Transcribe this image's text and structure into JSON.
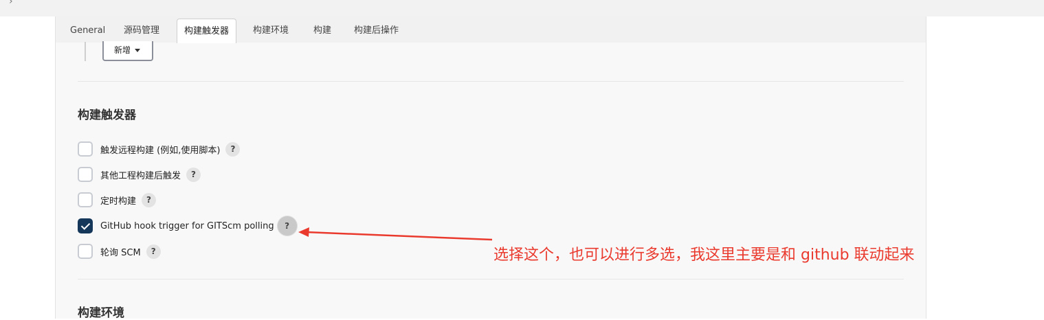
{
  "topbar": {
    "chevron": "›"
  },
  "tabs": [
    {
      "label": "General"
    },
    {
      "label": "源码管理"
    },
    {
      "label": "构建触发器",
      "active": true
    },
    {
      "label": "构建环境"
    },
    {
      "label": "构建"
    },
    {
      "label": "构建后操作"
    }
  ],
  "add_button": {
    "label": "新增",
    "icon": "caret-down-icon"
  },
  "triggers": {
    "title": "构建触发器",
    "options": [
      {
        "label": "触发远程构建 (例如,使用脚本)",
        "checked": false,
        "help": "?"
      },
      {
        "label": "其他工程构建后触发",
        "checked": false,
        "help": "?"
      },
      {
        "label": "定时构建",
        "checked": false,
        "help": "?"
      },
      {
        "label": "GitHub hook trigger for GITScm polling",
        "checked": true,
        "help": "?"
      },
      {
        "label": "轮询 SCM",
        "checked": false,
        "help": "?"
      }
    ]
  },
  "next_section": {
    "title": "构建环境"
  },
  "annotation": {
    "text": "选择这个，也可以进行多选，我这里主要是和 github 联动起来",
    "color": "#ea3a2e"
  },
  "colors": {
    "checked": "#14375a",
    "annotation": "#ea3a2e"
  }
}
